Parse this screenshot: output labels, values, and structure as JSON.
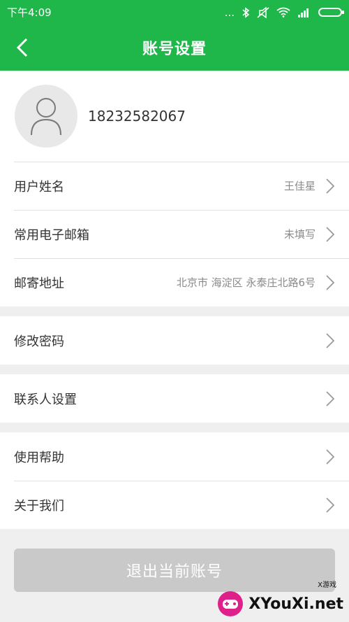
{
  "status_bar": {
    "time": "下午4:09",
    "dots": "...",
    "icons": [
      "bluetooth-icon",
      "mute-icon",
      "wifi-icon",
      "signal-icon",
      "battery-icon"
    ]
  },
  "header": {
    "title": "账号设置",
    "back_icon": "chevron-left-icon"
  },
  "profile": {
    "phone": "18232582067",
    "avatar_icon": "user-icon"
  },
  "info_group": [
    {
      "label": "用户姓名",
      "value": "王佳星"
    },
    {
      "label": "常用电子邮箱",
      "value": "未填写"
    },
    {
      "label": "邮寄地址",
      "value": "北京市 海淀区 永泰庄北路6号"
    }
  ],
  "password": {
    "label": "修改密码"
  },
  "contacts": {
    "label": "联系人设置"
  },
  "help_group": [
    {
      "label": "使用帮助"
    },
    {
      "label": "关于我们"
    }
  ],
  "logout": {
    "label": "退出当前账号"
  },
  "watermark": {
    "text": "XYouXi.net",
    "small": "X游戏"
  },
  "colors": {
    "accent": "#1fb64a",
    "logout_bg": "#c9c9c9"
  }
}
